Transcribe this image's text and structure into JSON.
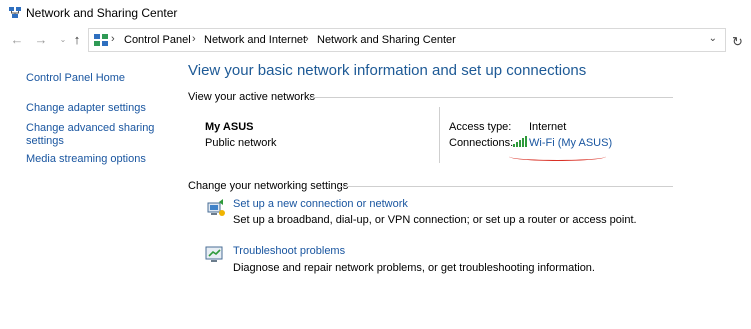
{
  "window": {
    "title": "Network and Sharing Center"
  },
  "breadcrumb": [
    "Control Panel",
    "Network and Internet",
    "Network and Sharing Center"
  ],
  "sidebar": {
    "home": "Control Panel Home",
    "links": [
      "Change adapter settings",
      "Change advanced sharing",
      "settings",
      "Media streaming options"
    ]
  },
  "main": {
    "title": "View your basic network information and set up connections",
    "active_networks_label": "View your active networks",
    "network": {
      "name": "My ASUS",
      "type": "Public network",
      "access_type_label": "Access type:",
      "access_type_value": "Internet",
      "connections_label": "Connections:",
      "connection_link": "Wi-Fi (My ASUS)"
    },
    "change_settings_label": "Change your networking settings",
    "tasks": [
      {
        "link": "Set up a new connection or network",
        "desc": "Set up a broadband, dial-up, or VPN connection; or set up a router or access point.",
        "icon": "new-connection-icon"
      },
      {
        "link": "Troubleshoot problems",
        "desc": "Diagnose and repair network problems, or get troubleshooting information.",
        "icon": "troubleshoot-icon"
      }
    ]
  },
  "colors": {
    "link": "#1a56a0",
    "title": "#1e5a96",
    "annotation": "#d93025"
  }
}
